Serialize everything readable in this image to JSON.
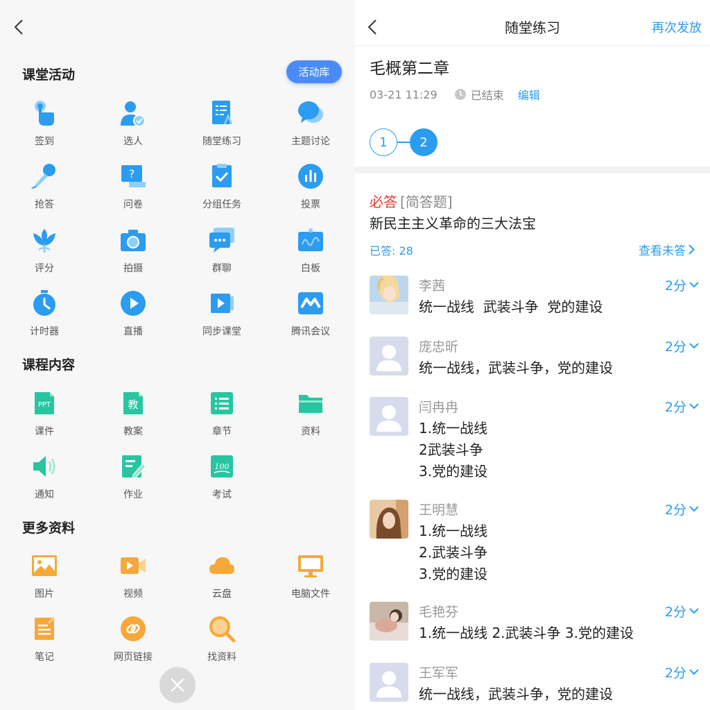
{
  "left": {
    "sections": {
      "class_activity": "课堂活动",
      "course_content": "课程内容",
      "more_materials": "更多资料"
    },
    "activity_library_button": "活动库",
    "activities": [
      {
        "label": "签到",
        "icon": "tap-hand-icon"
      },
      {
        "label": "选人",
        "icon": "pick-person-icon"
      },
      {
        "label": "随堂练习",
        "icon": "quiz-sheet-icon"
      },
      {
        "label": "主题讨论",
        "icon": "chat-bubbles-icon"
      },
      {
        "label": "抢答",
        "icon": "microphone-icon"
      },
      {
        "label": "问卷",
        "icon": "questionnaire-icon"
      },
      {
        "label": "分组任务",
        "icon": "clipboard-check-icon"
      },
      {
        "label": "投票",
        "icon": "bar-chart-icon"
      },
      {
        "label": "评分",
        "icon": "lotus-icon"
      },
      {
        "label": "拍摄",
        "icon": "camera-icon"
      },
      {
        "label": "群聊",
        "icon": "group-chat-icon"
      },
      {
        "label": "白板",
        "icon": "whiteboard-icon"
      },
      {
        "label": "计时器",
        "icon": "stopwatch-icon"
      },
      {
        "label": "直播",
        "icon": "play-circle-icon"
      },
      {
        "label": "同步课堂",
        "icon": "sync-class-icon"
      },
      {
        "label": "腾讯会议",
        "icon": "tencent-meeting-icon"
      }
    ],
    "content": [
      {
        "label": "课件",
        "icon": "ppt-file-icon",
        "badge": "PPT"
      },
      {
        "label": "教案",
        "icon": "lesson-plan-icon",
        "badge": "教"
      },
      {
        "label": "章节",
        "icon": "chapter-list-icon"
      },
      {
        "label": "资料",
        "icon": "folder-icon"
      },
      {
        "label": "通知",
        "icon": "speaker-icon"
      },
      {
        "label": "作业",
        "icon": "homework-edit-icon"
      },
      {
        "label": "考试",
        "icon": "exam-100-icon",
        "badge": "100"
      }
    ],
    "more": [
      {
        "label": "图片",
        "icon": "image-icon"
      },
      {
        "label": "视频",
        "icon": "video-icon"
      },
      {
        "label": "云盘",
        "icon": "cloud-icon"
      },
      {
        "label": "电脑文件",
        "icon": "monitor-icon"
      },
      {
        "label": "笔记",
        "icon": "note-icon"
      },
      {
        "label": "网页链接",
        "icon": "link-icon"
      },
      {
        "label": "找资料",
        "icon": "search-icon"
      }
    ],
    "colors": {
      "blue": "#2b9cf0",
      "green": "#27c6a1",
      "orange": "#f5a93a",
      "library_button": "#4b8bf5"
    }
  },
  "right": {
    "nav": {
      "title": "随堂练习",
      "action": "再次发放"
    },
    "exercise": {
      "title": "毛概第二章",
      "time": "03-21 11:29",
      "status": "已结束",
      "edit": "编辑"
    },
    "pages": [
      "1",
      "2"
    ],
    "current_page": "2",
    "question": {
      "required": "必答",
      "type": "[简答题]",
      "text": "新民主主义革命的三大法宝",
      "answered": "已答: 28",
      "view_unanswered": "查看未答"
    },
    "answers": [
      {
        "name": "李茜",
        "score": "2分",
        "text": "统一战线  武装斗争  党的建设",
        "avatar": "photo-anime"
      },
      {
        "name": "庞忠昕",
        "score": "2分",
        "text": "统一战线，武装斗争，党的建设",
        "avatar": "default"
      },
      {
        "name": "闫冉冉",
        "score": "2分",
        "text": "1.统一战线\n2武装斗争\n3.党的建设",
        "avatar": "default"
      },
      {
        "name": "王明慧",
        "score": "2分",
        "text": "1.统一战线\n2.武装斗争\n3.党的建设",
        "avatar": "photo-portrait"
      },
      {
        "name": "毛艳芬",
        "score": "2分",
        "text": "1.统一战线 2.武装斗争 3.党的建设",
        "avatar": "photo-pet"
      },
      {
        "name": "王军军",
        "score": "2分",
        "text": "统一战线，武装斗争，党的建设",
        "avatar": "default"
      }
    ],
    "colors": {
      "accent": "#2b9cf0",
      "required": "#e23b2e"
    }
  }
}
